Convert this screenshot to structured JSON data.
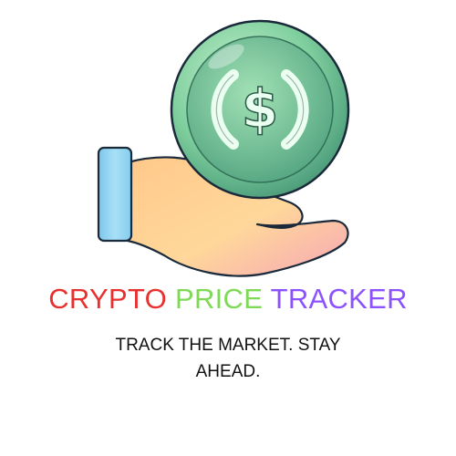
{
  "logo": {
    "icon": "hand-holding-dollar-coin-icon",
    "coin_symbol": "$",
    "colors": {
      "coin_light": "#b8ecc4",
      "coin_mid": "#6fc69a",
      "coin_dark": "#3e8f6a",
      "coin_highlight": "#eafff0",
      "cuff": "#8fd3f0",
      "hand_light": "#ffd38a",
      "hand_pink": "#f7a6b3",
      "hand_outline": "#1a2a3a"
    }
  },
  "title": {
    "word1": "CRYPTO",
    "word2": "PRICE",
    "word3": "TRACKER",
    "colors": {
      "word1": "#e8312f",
      "word2": "#7ed957",
      "word3": "#8c52ff"
    }
  },
  "tagline": "TRACK THE MARKET. STAY AHEAD."
}
